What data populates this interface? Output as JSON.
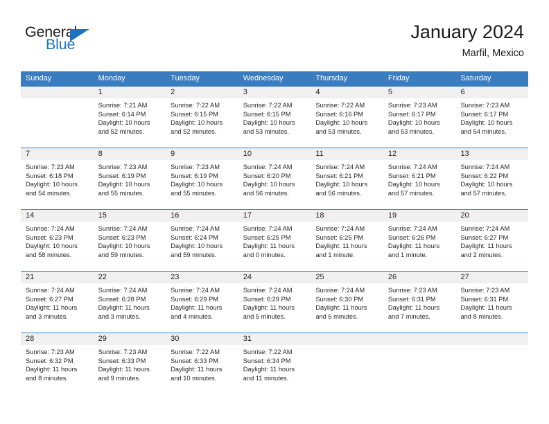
{
  "brand": {
    "word_general": "General",
    "word_blue": "Blue",
    "accent_color": "#1e73be"
  },
  "header": {
    "title": "January 2024",
    "location": "Marfil, Mexico",
    "header_bg_color": "#3a7cc0",
    "day_band_color": "#f0f0f0"
  },
  "weekdays": [
    "Sunday",
    "Monday",
    "Tuesday",
    "Wednesday",
    "Thursday",
    "Friday",
    "Saturday"
  ],
  "weeks": [
    [
      {
        "day": "",
        "sunrise": "",
        "sunset": "",
        "daylight": "",
        "empty": true
      },
      {
        "day": "1",
        "sunrise": "Sunrise: 7:21 AM",
        "sunset": "Sunset: 6:14 PM",
        "daylight": "Daylight: 10 hours and 52 minutes."
      },
      {
        "day": "2",
        "sunrise": "Sunrise: 7:22 AM",
        "sunset": "Sunset: 6:15 PM",
        "daylight": "Daylight: 10 hours and 52 minutes."
      },
      {
        "day": "3",
        "sunrise": "Sunrise: 7:22 AM",
        "sunset": "Sunset: 6:15 PM",
        "daylight": "Daylight: 10 hours and 53 minutes."
      },
      {
        "day": "4",
        "sunrise": "Sunrise: 7:22 AM",
        "sunset": "Sunset: 6:16 PM",
        "daylight": "Daylight: 10 hours and 53 minutes."
      },
      {
        "day": "5",
        "sunrise": "Sunrise: 7:23 AM",
        "sunset": "Sunset: 6:17 PM",
        "daylight": "Daylight: 10 hours and 53 minutes."
      },
      {
        "day": "6",
        "sunrise": "Sunrise: 7:23 AM",
        "sunset": "Sunset: 6:17 PM",
        "daylight": "Daylight: 10 hours and 54 minutes."
      }
    ],
    [
      {
        "day": "7",
        "sunrise": "Sunrise: 7:23 AM",
        "sunset": "Sunset: 6:18 PM",
        "daylight": "Daylight: 10 hours and 54 minutes."
      },
      {
        "day": "8",
        "sunrise": "Sunrise: 7:23 AM",
        "sunset": "Sunset: 6:19 PM",
        "daylight": "Daylight: 10 hours and 55 minutes."
      },
      {
        "day": "9",
        "sunrise": "Sunrise: 7:23 AM",
        "sunset": "Sunset: 6:19 PM",
        "daylight": "Daylight: 10 hours and 55 minutes."
      },
      {
        "day": "10",
        "sunrise": "Sunrise: 7:24 AM",
        "sunset": "Sunset: 6:20 PM",
        "daylight": "Daylight: 10 hours and 56 minutes."
      },
      {
        "day": "11",
        "sunrise": "Sunrise: 7:24 AM",
        "sunset": "Sunset: 6:21 PM",
        "daylight": "Daylight: 10 hours and 56 minutes."
      },
      {
        "day": "12",
        "sunrise": "Sunrise: 7:24 AM",
        "sunset": "Sunset: 6:21 PM",
        "daylight": "Daylight: 10 hours and 57 minutes."
      },
      {
        "day": "13",
        "sunrise": "Sunrise: 7:24 AM",
        "sunset": "Sunset: 6:22 PM",
        "daylight": "Daylight: 10 hours and 57 minutes."
      }
    ],
    [
      {
        "day": "14",
        "sunrise": "Sunrise: 7:24 AM",
        "sunset": "Sunset: 6:23 PM",
        "daylight": "Daylight: 10 hours and 58 minutes."
      },
      {
        "day": "15",
        "sunrise": "Sunrise: 7:24 AM",
        "sunset": "Sunset: 6:23 PM",
        "daylight": "Daylight: 10 hours and 59 minutes."
      },
      {
        "day": "16",
        "sunrise": "Sunrise: 7:24 AM",
        "sunset": "Sunset: 6:24 PM",
        "daylight": "Daylight: 10 hours and 59 minutes."
      },
      {
        "day": "17",
        "sunrise": "Sunrise: 7:24 AM",
        "sunset": "Sunset: 6:25 PM",
        "daylight": "Daylight: 11 hours and 0 minutes."
      },
      {
        "day": "18",
        "sunrise": "Sunrise: 7:24 AM",
        "sunset": "Sunset: 6:25 PM",
        "daylight": "Daylight: 11 hours and 1 minute."
      },
      {
        "day": "19",
        "sunrise": "Sunrise: 7:24 AM",
        "sunset": "Sunset: 6:26 PM",
        "daylight": "Daylight: 11 hours and 1 minute."
      },
      {
        "day": "20",
        "sunrise": "Sunrise: 7:24 AM",
        "sunset": "Sunset: 6:27 PM",
        "daylight": "Daylight: 11 hours and 2 minutes."
      }
    ],
    [
      {
        "day": "21",
        "sunrise": "Sunrise: 7:24 AM",
        "sunset": "Sunset: 6:27 PM",
        "daylight": "Daylight: 11 hours and 3 minutes."
      },
      {
        "day": "22",
        "sunrise": "Sunrise: 7:24 AM",
        "sunset": "Sunset: 6:28 PM",
        "daylight": "Daylight: 11 hours and 3 minutes."
      },
      {
        "day": "23",
        "sunrise": "Sunrise: 7:24 AM",
        "sunset": "Sunset: 6:29 PM",
        "daylight": "Daylight: 11 hours and 4 minutes."
      },
      {
        "day": "24",
        "sunrise": "Sunrise: 7:24 AM",
        "sunset": "Sunset: 6:29 PM",
        "daylight": "Daylight: 11 hours and 5 minutes."
      },
      {
        "day": "25",
        "sunrise": "Sunrise: 7:24 AM",
        "sunset": "Sunset: 6:30 PM",
        "daylight": "Daylight: 11 hours and 6 minutes."
      },
      {
        "day": "26",
        "sunrise": "Sunrise: 7:23 AM",
        "sunset": "Sunset: 6:31 PM",
        "daylight": "Daylight: 11 hours and 7 minutes."
      },
      {
        "day": "27",
        "sunrise": "Sunrise: 7:23 AM",
        "sunset": "Sunset: 6:31 PM",
        "daylight": "Daylight: 11 hours and 8 minutes."
      }
    ],
    [
      {
        "day": "28",
        "sunrise": "Sunrise: 7:23 AM",
        "sunset": "Sunset: 6:32 PM",
        "daylight": "Daylight: 11 hours and 8 minutes."
      },
      {
        "day": "29",
        "sunrise": "Sunrise: 7:23 AM",
        "sunset": "Sunset: 6:33 PM",
        "daylight": "Daylight: 11 hours and 9 minutes."
      },
      {
        "day": "30",
        "sunrise": "Sunrise: 7:22 AM",
        "sunset": "Sunset: 6:33 PM",
        "daylight": "Daylight: 11 hours and 10 minutes."
      },
      {
        "day": "31",
        "sunrise": "Sunrise: 7:22 AM",
        "sunset": "Sunset: 6:34 PM",
        "daylight": "Daylight: 11 hours and 11 minutes."
      },
      {
        "day": "",
        "sunrise": "",
        "sunset": "",
        "daylight": "",
        "empty": true
      },
      {
        "day": "",
        "sunrise": "",
        "sunset": "",
        "daylight": "",
        "empty": true
      },
      {
        "day": "",
        "sunrise": "",
        "sunset": "",
        "daylight": "",
        "empty": true
      }
    ]
  ]
}
